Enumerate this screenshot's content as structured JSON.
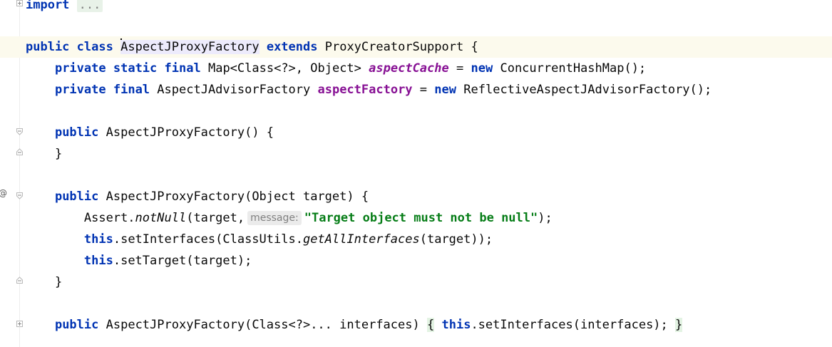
{
  "editor": {
    "import_keyword": "import",
    "import_fold": "...",
    "class_decl": {
      "mod1": "public",
      "mod2": "class",
      "name": "AspectJProxyFactory",
      "extends_kw": "extends",
      "super": "ProxyCreatorSupport",
      "brace": "{"
    },
    "field1": {
      "mods": [
        "private",
        "static",
        "final"
      ],
      "type": "Map<Class<?>, Object>",
      "name": "aspectCache",
      "eq": "=",
      "new_kw": "new",
      "init": "ConcurrentHashMap();"
    },
    "field2": {
      "mods": [
        "private",
        "final"
      ],
      "type": "AspectJAdvisorFactory",
      "name": "aspectFactory",
      "eq": "=",
      "new_kw": "new",
      "init": "ReflectiveAspectJAdvisorFactory();"
    },
    "ctor1": {
      "mod": "public",
      "sig": "AspectJProxyFactory() {",
      "close": "}"
    },
    "ctor2": {
      "mod": "public",
      "sig": "AspectJProxyFactory(Object target) {",
      "assert_obj": "Assert.",
      "assert_method": "notNull",
      "assert_args_start": "(target,",
      "hint_label": "message:",
      "assert_str": "\"Target object must not be null\"",
      "assert_end": ");",
      "this_kw": "this",
      "set_ifaces": ".setInterfaces(ClassUtils.",
      "get_all": "getAllInterfaces",
      "set_ifaces_end": "(target));",
      "set_target": ".setTarget(target);",
      "close": "}"
    },
    "ctor3": {
      "mod": "public",
      "sig": "AspectJProxyFactory(Class<?>... interfaces)",
      "open": "{",
      "this_kw": "this",
      "body": ".setInterfaces(interfaces);",
      "close": "}"
    },
    "gutter": {
      "override_marker": "@"
    }
  }
}
